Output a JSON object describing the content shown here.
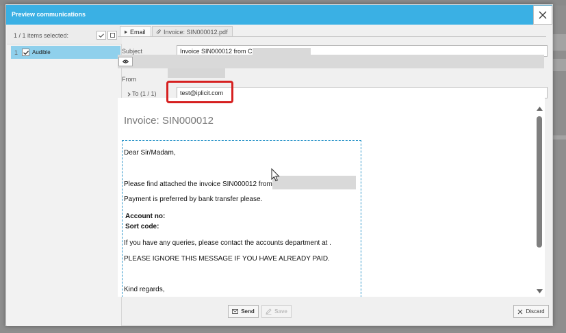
{
  "window": {
    "title": "Preview communications"
  },
  "selection": {
    "count_label": "1 / 1 items selected:"
  },
  "items": [
    {
      "index": "1",
      "name": "Audible",
      "checked": true
    }
  ],
  "tabs": [
    {
      "label": "Email",
      "active": true
    },
    {
      "label": "Invoice: SIN000012.pdf",
      "active": false
    }
  ],
  "fields": {
    "subject_label": "Subject",
    "subject_value": "Invoice SIN000012 from C",
    "from_label": "From",
    "to_label": "To (1 / 1)",
    "to_value": "test@iplicit.com"
  },
  "preview": {
    "title": "Invoice: SIN000012",
    "greeting": "Dear Sir/Madam,",
    "line1": "Please find attached the invoice SIN000012 from",
    "line2": "Payment is preferred by bank transfer please.",
    "account_label": "Account no:",
    "sort_label": "Sort code:",
    "line3": "If you have any queries, please contact the accounts department at .",
    "line4": "PLEASE IGNORE THIS MESSAGE IF YOU HAVE ALREADY PAID.",
    "closing": "Kind regards,"
  },
  "buttons": {
    "send": "Send",
    "save": "Save",
    "discard": "Discard"
  },
  "colors": {
    "titlebar": "#3ab0e4",
    "selected_row": "#8fd0ec",
    "highlight": "#d62020",
    "dashed_border": "#2a94c9"
  },
  "icons": [
    "close-icon",
    "check-all-icon",
    "uncheck-all-icon",
    "checkbox-checked-icon",
    "email-tab-arrow-icon",
    "attachment-icon",
    "eye-icon",
    "expand-arrow-icon",
    "envelope-icon",
    "pencil-icon",
    "close-x-icon"
  ]
}
